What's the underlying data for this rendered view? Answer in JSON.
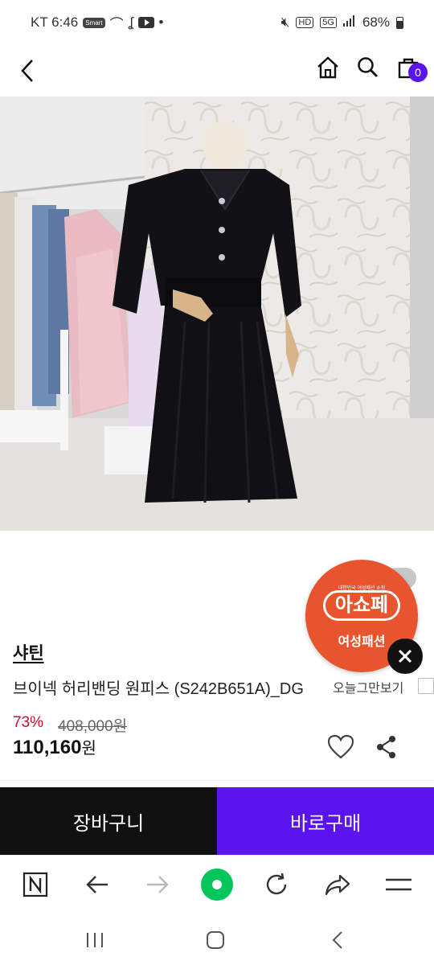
{
  "status_bar": {
    "carrier_time": "KT 6:46",
    "badge": "Smart",
    "network": "5G",
    "hd": "HD",
    "battery": "68%"
  },
  "header": {
    "cart_count": "0"
  },
  "product": {
    "brand": "샤틴",
    "name": "브이넥 허리밴딩 원피스 (S242B651A)_DG",
    "discount": "73%",
    "original_price": "408,000원",
    "sale_price_number": "110,160",
    "sale_price_unit": "원"
  },
  "overlay": {
    "link_text": "오늘그만보기"
  },
  "promo": {
    "small_text": "대한민국 여성패션 쇼핑",
    "logo_text": "아쇼페",
    "sub_text": "여성패션"
  },
  "actions": {
    "cart_label": "장바구니",
    "buy_label": "바로구매"
  },
  "colors": {
    "accent": "#5b14f0",
    "discount": "#c8102e",
    "promo": "#e8542e",
    "naver_green": "#03c75a"
  },
  "icons": {
    "back": "back-icon",
    "home": "home-icon",
    "search": "search-icon",
    "cart": "cart-icon",
    "heart": "heart-icon",
    "share": "share-icon",
    "close": "close-icon"
  }
}
